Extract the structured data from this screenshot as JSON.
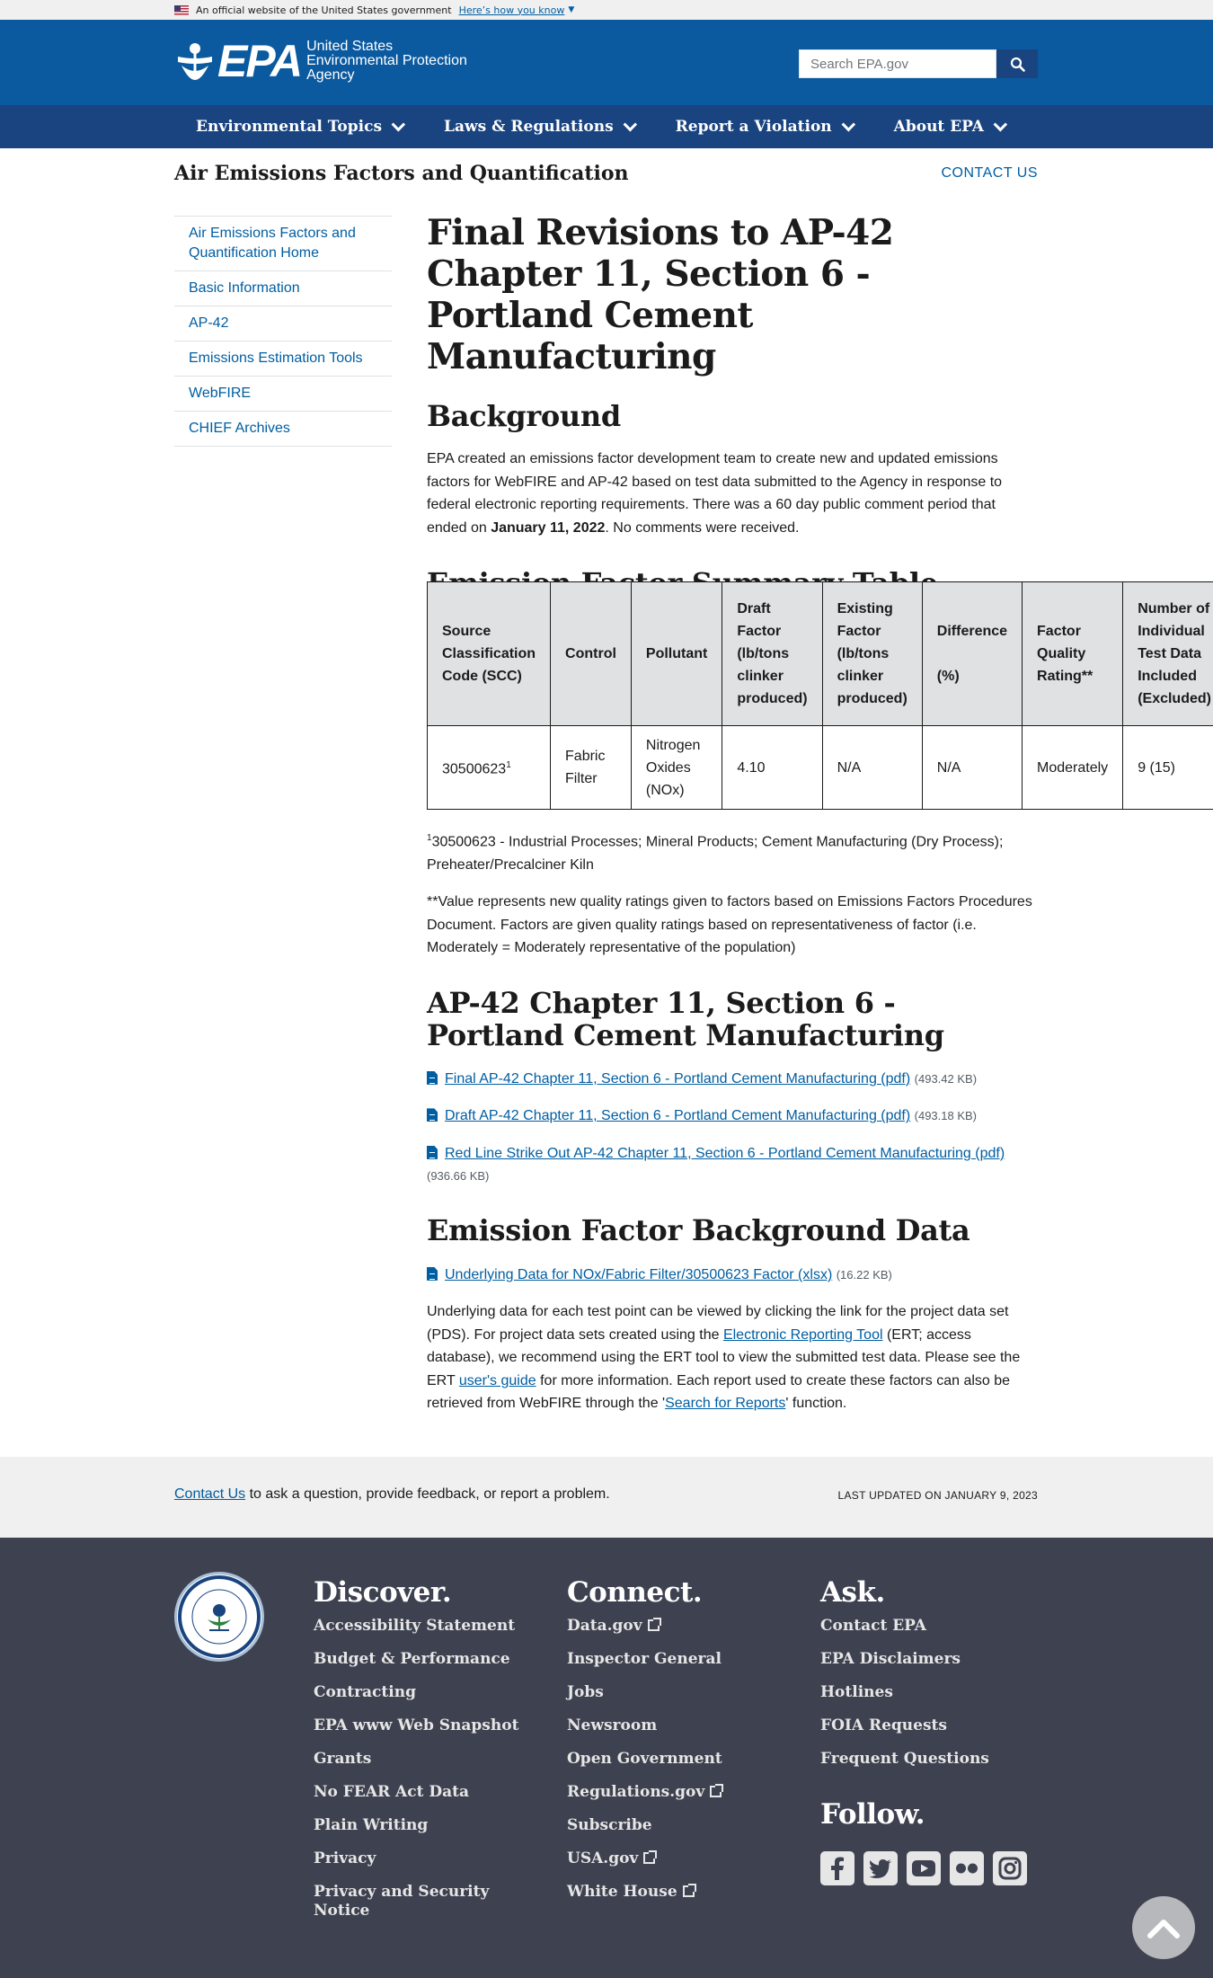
{
  "banner": {
    "text": "An official website of the United States government",
    "how": "Here’s how you know"
  },
  "masthead": {
    "logo": "EPA",
    "agency": [
      "United States",
      "Environmental Protection",
      "Agency"
    ],
    "search_placeholder": "Search EPA.gov"
  },
  "nav": [
    "Environmental Topics",
    "Laws & Regulations",
    "Report a Violation",
    "About EPA"
  ],
  "site_header": {
    "title": "Air Emissions Factors and Quantification",
    "contact": "CONTACT US"
  },
  "sidenav": [
    "Air Emissions Factors and Quantification Home",
    "Basic Information",
    "AP-42",
    "Emissions Estimation Tools",
    "WebFIRE",
    "CHIEF Archives"
  ],
  "main": {
    "title": "Final Revisions to AP-42 Chapter 11, Section 6 - Portland Cement Manufacturing",
    "background_heading": "Background",
    "background_p1": "EPA created an emissions factor development team to create new and updated emissions factors for WebFIRE and AP-42 based on test data submitted to the Agency in response to federal electronic reporting requirements.  There was a 60 day public comment period that ended on ",
    "background_date": "January 11, 2022",
    "background_p2": ".  No comments were received.",
    "summary_heading": "Emission Factor Summary Table",
    "table": {
      "headers": [
        "Source Classification Code (SCC)",
        "Control",
        "Pollutant",
        "Draft Factor (lb/tons clinker produced)",
        "Existing Factor (lb/tons clinker produced)",
        "Difference\n\n(%)",
        "Factor Quality Rating**",
        "Number of Individual Test Data Included (Excluded)"
      ],
      "row": {
        "scc": "30500623",
        "scc_sup": "1",
        "control": "Fabric Filter",
        "pollutant": "Nitrogen Oxides (NOx)",
        "draft": "4.10",
        "existing": "N/A",
        "difference": "N/A",
        "rating": "Moderately",
        "count": "9 (15)"
      }
    },
    "footnote1_sup": "1",
    "footnote1": "30500623 - Industrial Processes; Mineral Products; Cement Manufacturing (Dry Process); Preheater/Precalciner Kiln",
    "footnote2": "**Value represents new quality ratings given to factors based on Emissions Factors Procedures Document. Factors are given quality ratings based on representativeness of factor (i.e. Moderately = Moderately representative of the population)",
    "ap42_heading": "AP-42 Chapter 11, Section 6 - Portland Cement Manufacturing",
    "files": [
      {
        "label": "Final AP-42 Chapter 11, Section 6 - Portland Cement Manufacturing (pdf)",
        "size": "(493.42 KB)"
      },
      {
        "label": "Draft AP-42 Chapter 11, Section 6 - Portland Cement Manufacturing (pdf)",
        "size": "(493.18 KB)"
      },
      {
        "label": "Red Line Strike Out AP-42 Chapter 11, Section 6 - Portland Cement Manufacturing (pdf)",
        "size": "(936.66 KB)"
      }
    ],
    "bg_data_heading": "Emission Factor Background Data",
    "bg_file": {
      "label": "Underlying Data for NOx/Fabric Filter/30500623 Factor (xlsx)",
      "size": "(16.22 KB)"
    },
    "bg_p": {
      "t1": "Underlying data for each test point can be viewed by clicking the link for the project data set (PDS). For project data sets created using the ",
      "l1": "Electronic Reporting Tool",
      "t2": " (ERT; access database), we recommend using the ERT tool to view the submitted test data. Please see the ERT ",
      "l2": "user's guide",
      "t3": " for more information. Each report used to create these factors can also be retrieved from WebFIRE through the '",
      "l3": "Search for Reports",
      "t4": "' function."
    }
  },
  "lastbar": {
    "contact_link": "Contact Us",
    "contact_text": " to ask a question, provide feedback, or report a problem.",
    "updated": "LAST UPDATED ON JANUARY 9, 2023"
  },
  "footer": {
    "discover": {
      "heading": "Discover.",
      "links": [
        "Accessibility Statement",
        "Budget & Performance",
        "Contracting",
        "EPA www Web Snapshot",
        "Grants",
        "No FEAR Act Data",
        "Plain Writing",
        "Privacy",
        "Privacy and Security Notice"
      ]
    },
    "connect": {
      "heading": "Connect.",
      "links": [
        "Data.gov",
        "Inspector General",
        "Jobs",
        "Newsroom",
        "Open Government",
        "Regulations.gov",
        "Subscribe",
        "USA.gov",
        "White House"
      ]
    },
    "ask": {
      "heading": "Ask.",
      "links": [
        "Contact EPA",
        "EPA Disclaimers",
        "Hotlines",
        "FOIA Requests",
        "Frequent Questions"
      ]
    },
    "follow": {
      "heading": "Follow.",
      "icons": [
        "facebook-icon",
        "twitter-icon",
        "youtube-icon",
        "flickr-icon",
        "instagram-icon"
      ]
    }
  },
  "colors": {
    "masthead": "#0b5aa0",
    "nav": "#1a4480",
    "link": "#005ea2",
    "footer": "#3e4250"
  }
}
